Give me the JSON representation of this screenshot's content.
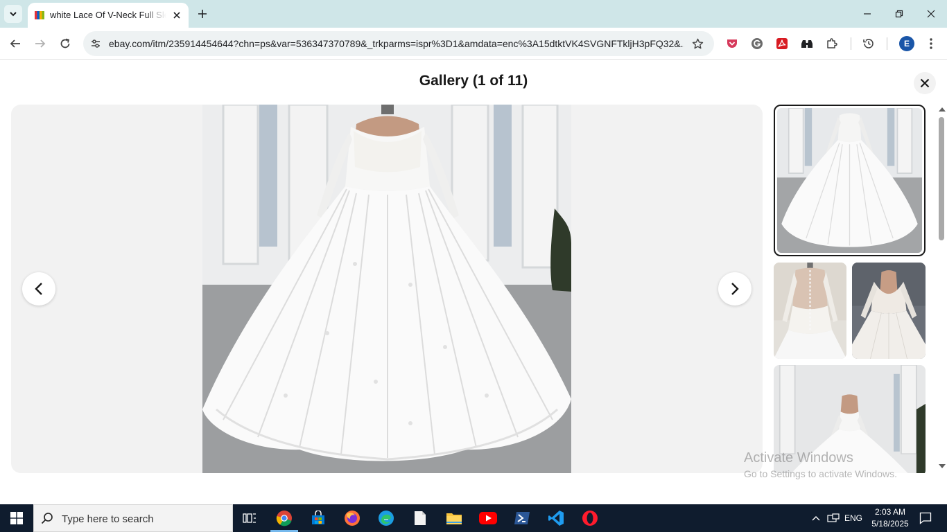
{
  "browser": {
    "tab": {
      "title": "white Lace Of V-Neck Full Sleeve",
      "favicon": "ebay-favicon-icon"
    },
    "url": "ebay.com/itm/235914454644?chn=ps&var=536347370789&_trkparms=ispr%3D1&amdata=enc%3A15dtktVK4SVGNFTkljH3pFQ32&...",
    "profile_initial": "E",
    "accent": "#cfe6e8"
  },
  "gallery": {
    "title": "Gallery (1 of 11)",
    "current_index": 1,
    "total": 11,
    "main_image": "white lace ball gown wedding dress on mannequin",
    "thumbnails": [
      {
        "alt": "wedding dress front view",
        "selected": true
      },
      {
        "alt": "wedding dress back view with buttons",
        "selected": false
      },
      {
        "alt": "wedding dress bodice close-up",
        "selected": false
      },
      {
        "alt": "wedding dress front view in room",
        "selected": false
      }
    ]
  },
  "watermark": {
    "title": "Activate Windows",
    "subtitle": "Go to Settings to activate Windows."
  },
  "taskbar": {
    "search_placeholder": "Type here to search",
    "language": "ENG",
    "time": "2:03 AM",
    "date": "5/18/2025",
    "background": "#0f1c2e"
  }
}
